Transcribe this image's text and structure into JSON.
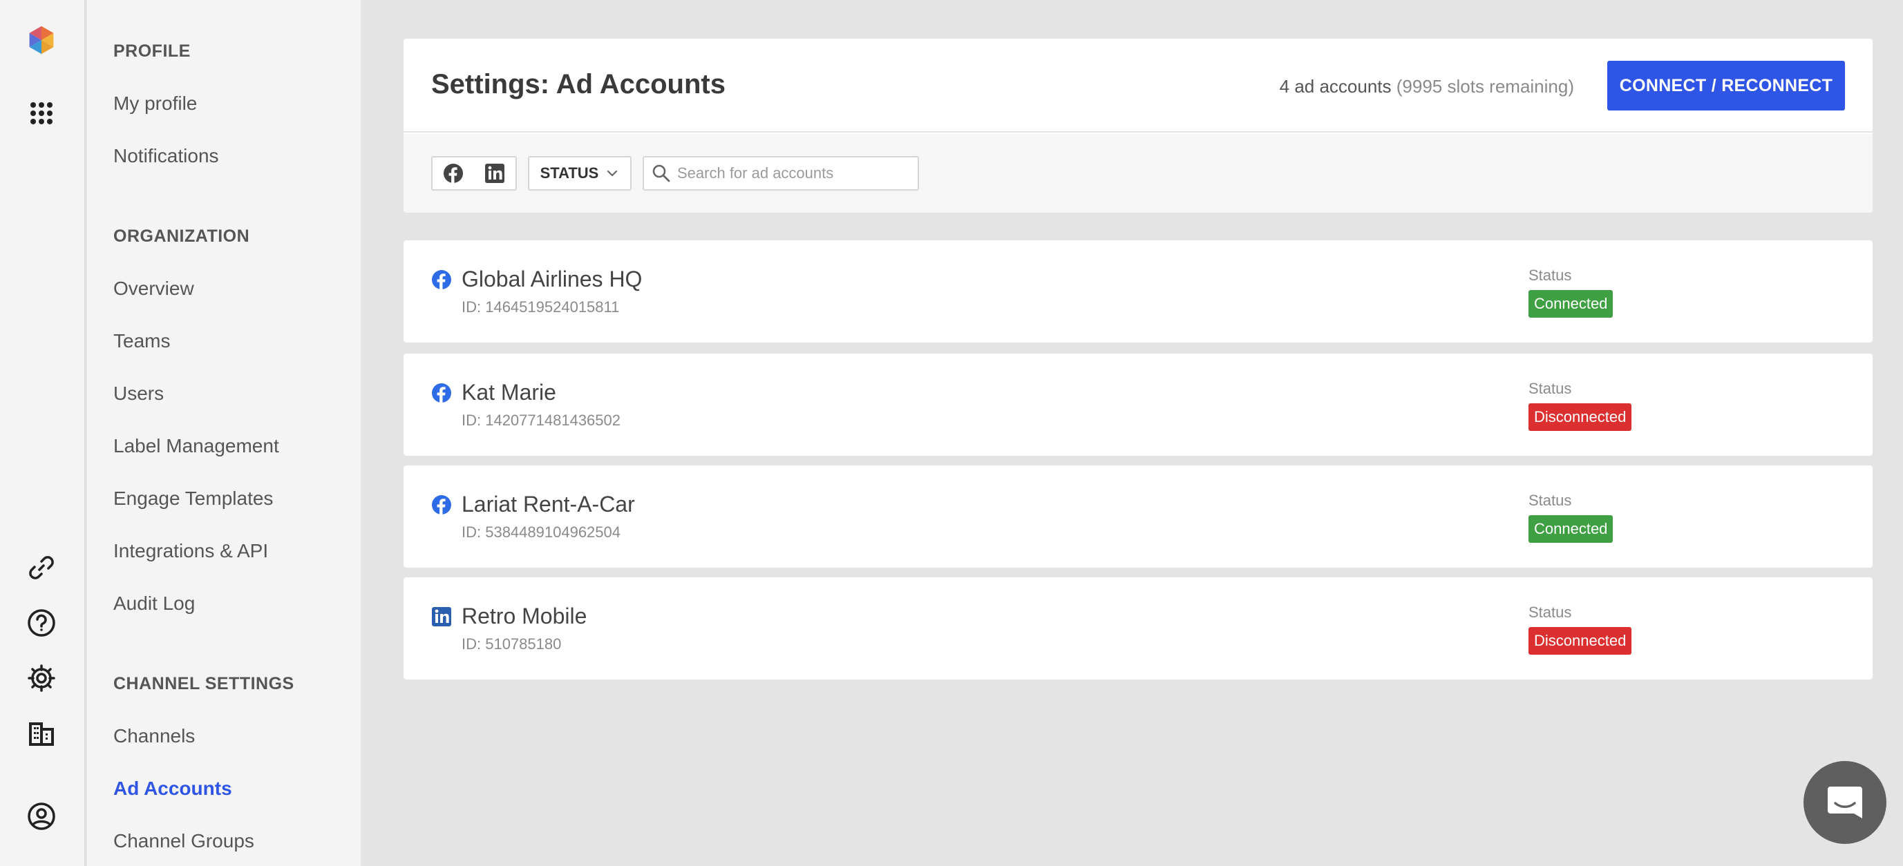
{
  "colors": {
    "accent": "#2e55e6",
    "connected": "#3ea043",
    "disconnected": "#dc3030",
    "facebook": "#2e6be6",
    "linkedin": "#2a5fb0"
  },
  "rail": {
    "items": [
      {
        "name": "app-logo-icon"
      },
      {
        "name": "apps-grid-icon"
      },
      {
        "name": "link-icon"
      },
      {
        "name": "help-icon"
      },
      {
        "name": "gear-icon"
      },
      {
        "name": "building-icon"
      },
      {
        "name": "user-circle-icon"
      }
    ]
  },
  "sidebar": {
    "profile": {
      "heading": "PROFILE",
      "items": [
        "My profile",
        "Notifications"
      ]
    },
    "organization": {
      "heading": "ORGANIZATION",
      "items": [
        "Overview",
        "Teams",
        "Users",
        "Label Management",
        "Engage Templates",
        "Integrations & API",
        "Audit Log"
      ]
    },
    "channel_settings": {
      "heading": "CHANNEL SETTINGS",
      "items": [
        "Channels",
        "Ad Accounts",
        "Channel Groups"
      ],
      "active": "Ad Accounts"
    }
  },
  "header": {
    "title": "Settings: Ad Accounts",
    "count": "4 ad accounts",
    "remaining": "(9995 slots remaining)",
    "connect_label": "CONNECT / RECONNECT"
  },
  "filters": {
    "networks": [
      {
        "icon": "facebook-icon"
      },
      {
        "icon": "linkedin-icon"
      }
    ],
    "status_label": "STATUS",
    "search_placeholder": "Search for ad accounts",
    "search_value": ""
  },
  "accounts": [
    {
      "network": "facebook",
      "name": "Global Airlines HQ",
      "id": "ID: 1464519524015811",
      "status_label": "Status",
      "status": "Connected"
    },
    {
      "network": "facebook",
      "name": "Kat Marie",
      "id": "ID: 1420771481436502",
      "status_label": "Status",
      "status": "Disconnected"
    },
    {
      "network": "facebook",
      "name": "Lariat Rent-A-Car",
      "id": "ID: 5384489104962504",
      "status_label": "Status",
      "status": "Connected"
    },
    {
      "network": "linkedin",
      "name": "Retro Mobile",
      "id": "ID: 510785180",
      "status_label": "Status",
      "status": "Disconnected"
    }
  ]
}
